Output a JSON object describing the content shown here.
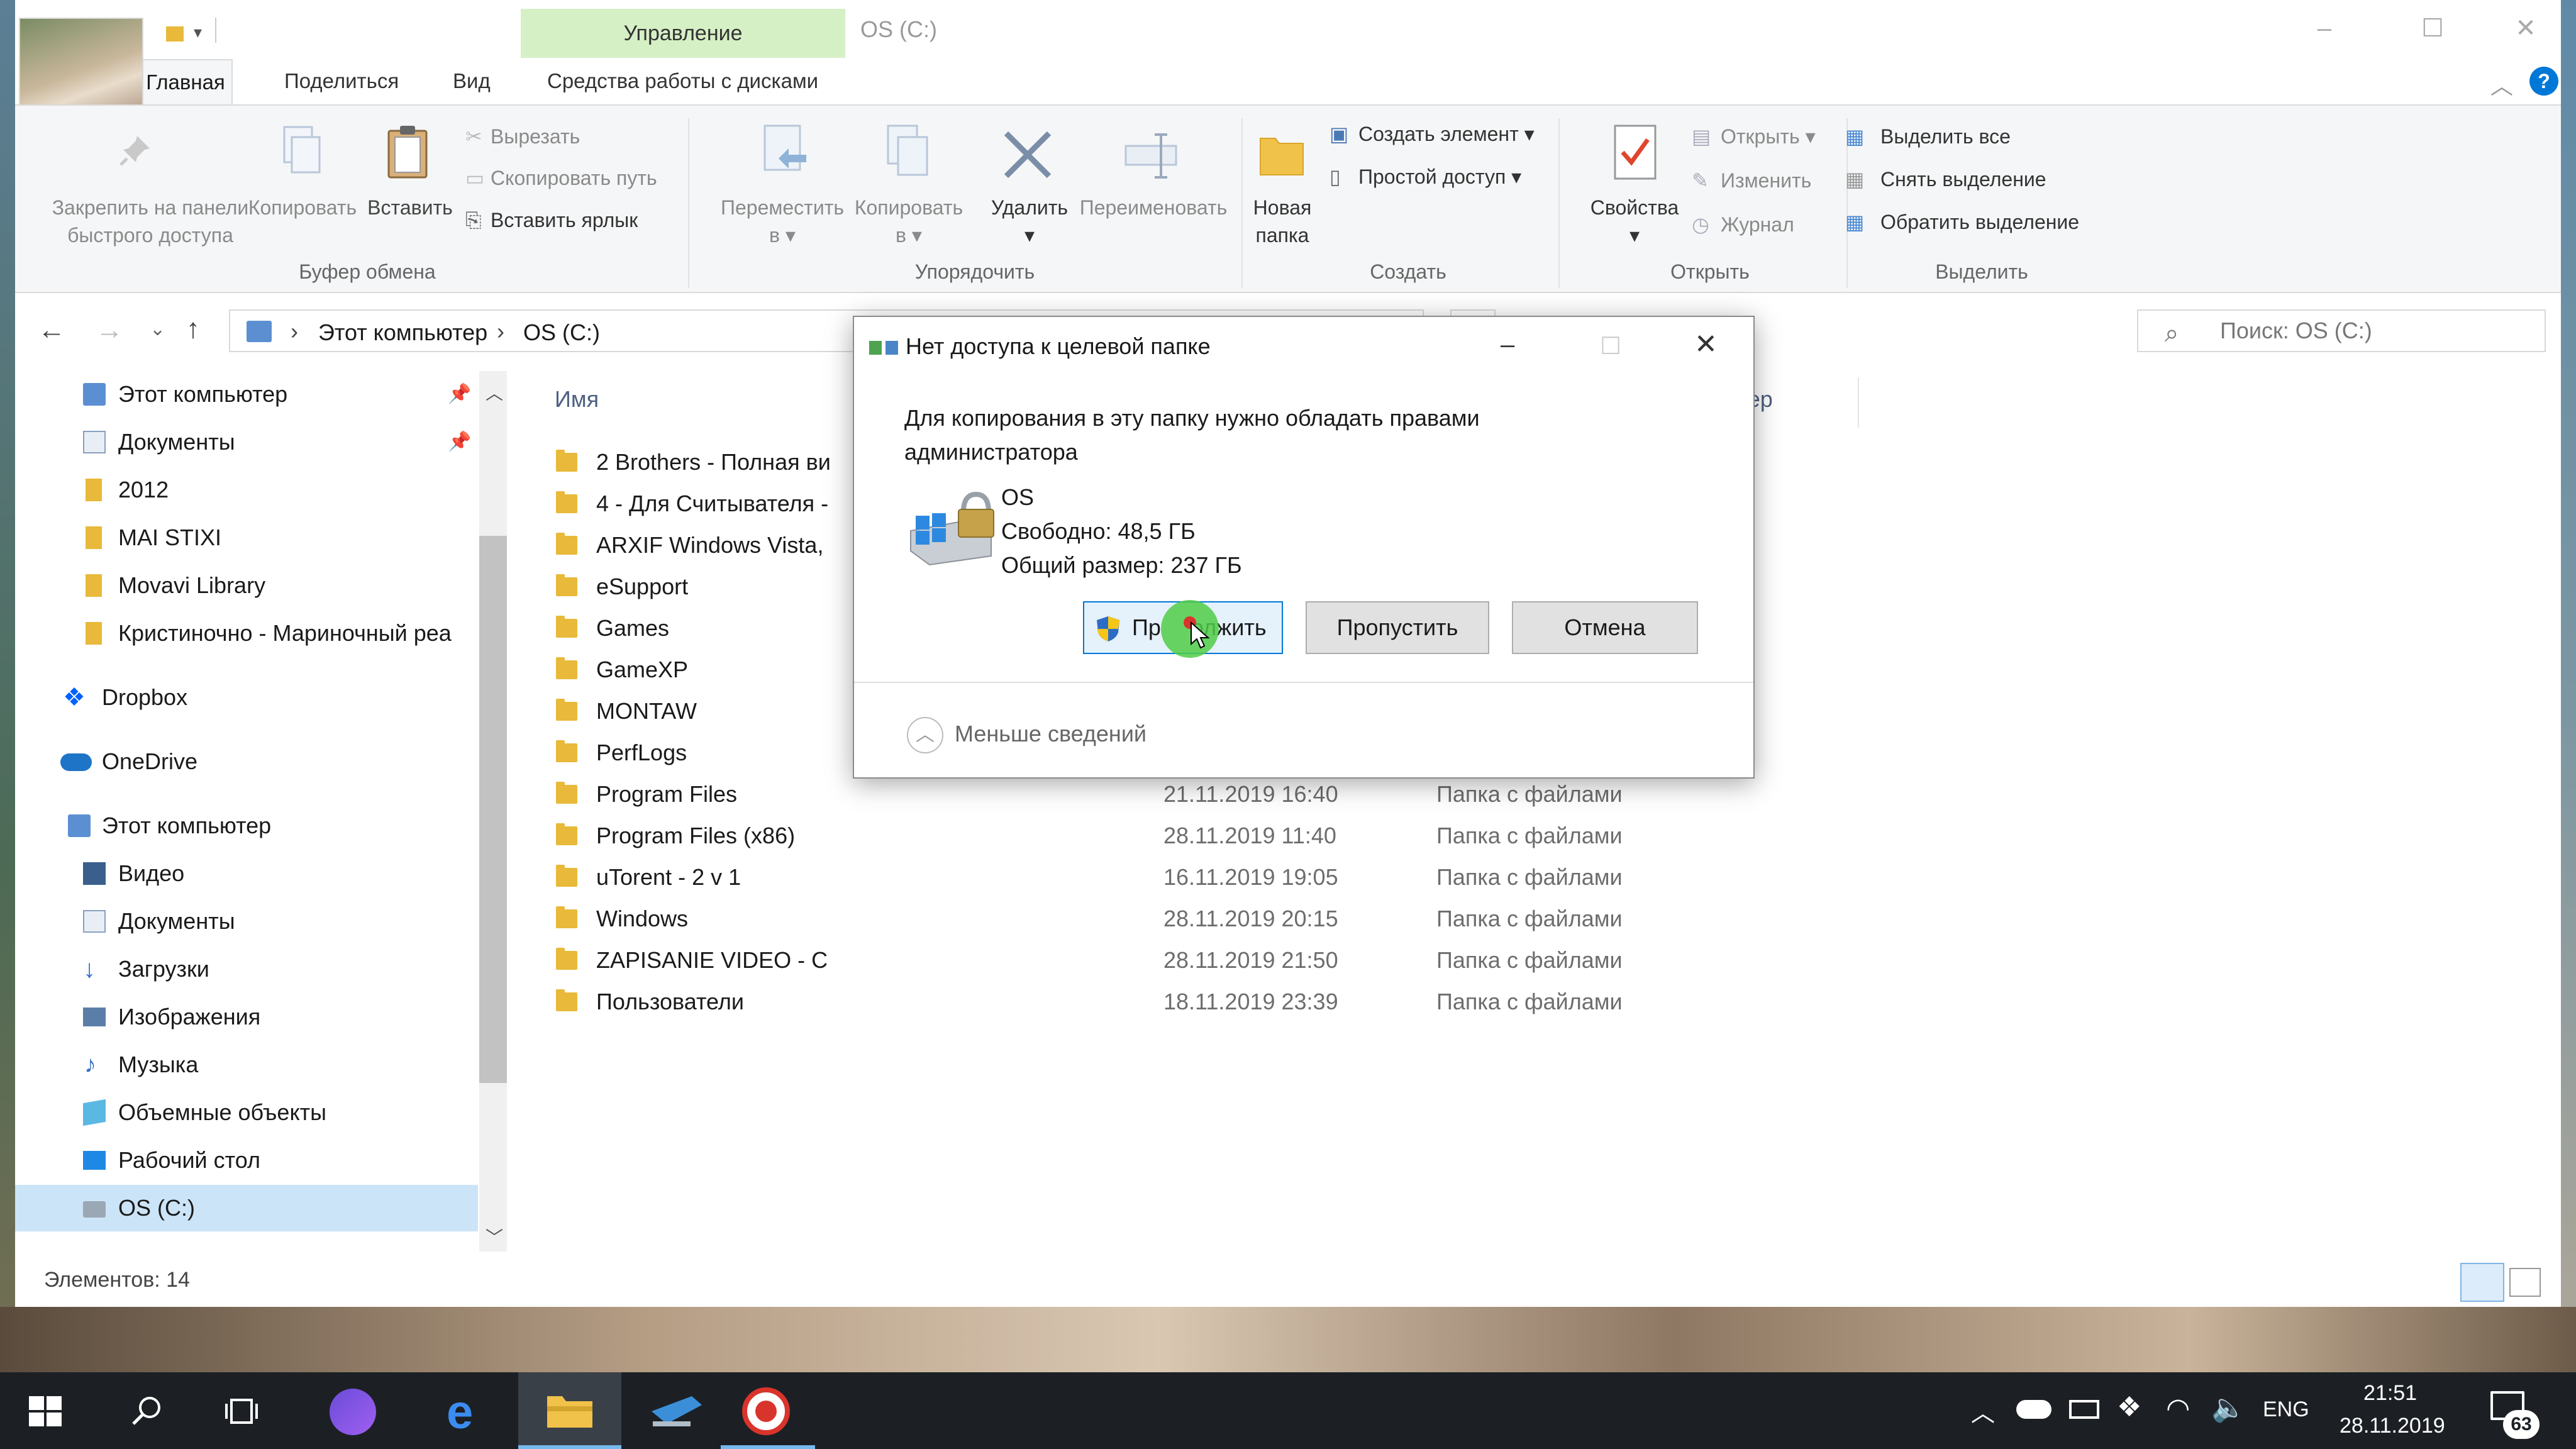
{
  "window": {
    "title": "OS (C:)",
    "manage_tab": "Управление",
    "tabs": [
      "Главная",
      "Поделиться",
      "Вид",
      "Средства работы с дисками"
    ]
  },
  "ribbon": {
    "clipboard": {
      "pin": "Закрепить на панели быстрого доступа",
      "pin_line1": "Закрепить на панели",
      "pin_line2": "быстрого доступа",
      "copy": "Копировать",
      "paste": "Вставить",
      "cut": "Вырезать",
      "copy_path": "Скопировать путь",
      "paste_shortcut": "Вставить ярлык",
      "group": "Буфер обмена"
    },
    "organize": {
      "move_line1": "Переместить",
      "move_line2": "в",
      "copy_line1": "Копировать",
      "copy_line2": "в",
      "delete": "Удалить",
      "rename": "Переименовать",
      "group": "Упорядочить"
    },
    "create": {
      "new_folder_line1": "Новая",
      "new_folder_line2": "папка",
      "new_item": "Создать элемент",
      "easy_access": "Простой доступ",
      "group": "Создать"
    },
    "open": {
      "properties": "Свойства",
      "open": "Открыть",
      "edit": "Изменить",
      "history": "Журнал",
      "group": "Открыть"
    },
    "select": {
      "select_all": "Выделить все",
      "select_none": "Снять выделение",
      "invert": "Обратить выделение",
      "group": "Выделить"
    }
  },
  "address": {
    "crumbs": [
      "Этот компьютер",
      "OS (C:)"
    ],
    "search_placeholder": "Поиск: OS (C:)"
  },
  "nav": {
    "items": [
      {
        "label": "Этот компьютер",
        "icon": "computer-icon",
        "pinned": true
      },
      {
        "label": "Документы",
        "icon": "documents-icon",
        "pinned": true
      },
      {
        "label": "2012",
        "icon": "folder-icon"
      },
      {
        "label": "MAI STIXI",
        "icon": "folder-icon"
      },
      {
        "label": "Movavi Library",
        "icon": "folder-icon"
      },
      {
        "label": "Кристиночно - Мариночный реа",
        "icon": "folder-icon"
      },
      {
        "label": "Dropbox",
        "icon": "dropbox-icon"
      },
      {
        "label": "OneDrive",
        "icon": "onedrive-icon"
      },
      {
        "label": "Этот компьютер",
        "icon": "computer-icon"
      },
      {
        "label": "Видео",
        "icon": "video-icon"
      },
      {
        "label": "Документы",
        "icon": "documents-icon"
      },
      {
        "label": "Загрузки",
        "icon": "downloads-icon"
      },
      {
        "label": "Изображения",
        "icon": "pictures-icon"
      },
      {
        "label": "Музыка",
        "icon": "music-icon"
      },
      {
        "label": "Объемные объекты",
        "icon": "3d-objects-icon"
      },
      {
        "label": "Рабочий стол",
        "icon": "desktop-icon"
      },
      {
        "label": "OS (C:)",
        "icon": "drive-icon",
        "selected": true
      }
    ]
  },
  "files": {
    "column_name": "Имя",
    "column_size_partial": "мер",
    "rows": [
      {
        "name": "2 Brothers - Полная ви",
        "date": "",
        "type": ""
      },
      {
        "name": "4 - Для Считывателя -",
        "date": "",
        "type": ""
      },
      {
        "name": "ARXIF Windows Vista,",
        "date": "",
        "type": ""
      },
      {
        "name": "eSupport",
        "date": "",
        "type": ""
      },
      {
        "name": "Games",
        "date": "",
        "type": ""
      },
      {
        "name": "GameXP",
        "date": "",
        "type": ""
      },
      {
        "name": "MONTAW",
        "date": "",
        "type": ""
      },
      {
        "name": "PerfLogs",
        "date": "",
        "type": ""
      },
      {
        "name": "Program Files",
        "date": "21.11.2019 16:40",
        "type": "Папка с файлами"
      },
      {
        "name": "Program Files (x86)",
        "date": "28.11.2019 11:40",
        "type": "Папка с файлами"
      },
      {
        "name": "uTorent - 2 v 1",
        "date": "16.11.2019 19:05",
        "type": "Папка с файлами"
      },
      {
        "name": "Windows",
        "date": "28.11.2019 20:15",
        "type": "Папка с файлами"
      },
      {
        "name": "ZAPISANIE VIDEO - C",
        "date": "28.11.2019 21:50",
        "type": "Папка с файлами"
      },
      {
        "name": "Пользователи",
        "date": "18.11.2019 23:39",
        "type": "Папка с файлами"
      }
    ]
  },
  "status": {
    "items_count": "Элементов: 14"
  },
  "dialog": {
    "title": "Нет доступа к целевой папке",
    "message_line1": "Для копирования в эту папку нужно обладать правами",
    "message_line2": "администратора",
    "drive_name": "OS",
    "free": "Свободно: 48,5 ГБ",
    "total": "Общий размер: 237 ГБ",
    "continue": "Продолжить",
    "continue_visible_start": "Пр",
    "continue_visible_end": "олжить",
    "skip": "Пропустить",
    "cancel": "Отмена",
    "less_details": "Меньше сведений"
  },
  "taskbar": {
    "lang": "ENG",
    "time": "21:51",
    "date": "28.11.2019",
    "notifications": "63"
  },
  "colors": {
    "accent": "#0078d7",
    "manage_tab": "#d6f0c6",
    "folder": "#e8b93a",
    "taskbar": "#1c2025",
    "cursor_highlight": "#5ed35e"
  }
}
